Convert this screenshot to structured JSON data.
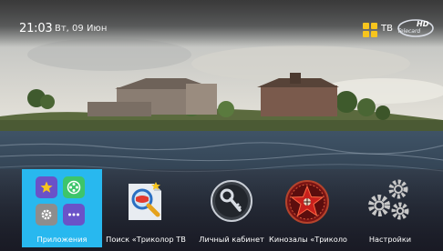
{
  "status_bar": {
    "time": "21:03",
    "date": "Вт, 09 Июн",
    "tv_label": "ТВ",
    "hd_badge": "HD",
    "brand": "Telecard"
  },
  "menu": {
    "items": [
      {
        "label": "Приложения",
        "icon": "apps-grid-icon",
        "active": true
      },
      {
        "label": "Поиск «Триколор ТВ",
        "icon": "search-magnifier-icon",
        "active": false
      },
      {
        "label": "Личный кабинет",
        "icon": "key-icon",
        "active": false
      },
      {
        "label": "Кинозалы «Триколо",
        "icon": "cinema-star-icon",
        "active": false
      },
      {
        "label": "Настройки",
        "icon": "gears-icon",
        "active": false
      }
    ]
  },
  "colors": {
    "active_tile": "#28b8ef",
    "accent_yellow": "#f7c51e",
    "apps_purple": "#6a52c8",
    "apps_green": "#3dc56b",
    "apps_gray": "#8d8d8d"
  }
}
